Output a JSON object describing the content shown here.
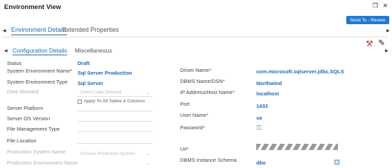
{
  "window": {
    "title": "Environment View",
    "restore_icon": "❐",
    "close_icon": "✕"
  },
  "send_button": "Send To - Review",
  "outer_tabs": [
    {
      "label": "Environment Details",
      "active": true
    },
    {
      "label": "Extended Properties",
      "active": false
    }
  ],
  "inner_tabs": [
    {
      "label": "Configuration Details",
      "active": true
    },
    {
      "label": "Miscellaneous",
      "active": false
    }
  ],
  "left_fields": {
    "status": {
      "label": "Status",
      "value": "Draft"
    },
    "sys_env_name": {
      "label": "System Environment Name",
      "required": "*",
      "value": "Sql Server Production"
    },
    "sys_env_type": {
      "label": "System Environment Type",
      "value": "Sql Server"
    },
    "data_steward": {
      "label": "Data Steward",
      "placeholder": "Select Data Steward"
    },
    "apply_all": {
      "label": "Apply To All Tables & Columns"
    },
    "server_platform": {
      "label": "Server Platform"
    },
    "server_os": {
      "label": "Server OS Version"
    },
    "file_mgmt": {
      "label": "File Management Type"
    },
    "file_location": {
      "label": "File Location"
    },
    "prod_sys_name": {
      "label": "Production System Name",
      "placeholder": "Choose Production System"
    },
    "prod_env_name": {
      "label": "Production Environment Name"
    }
  },
  "right_fields": {
    "driver_name": {
      "label": "Driver Name",
      "required": "*",
      "value": "com.microsoft.sqlserver.jdbc.SQLS"
    },
    "dbms_name": {
      "label": "DBMS Name/DSN",
      "required": "*",
      "value": "Northwind"
    },
    "ip_address": {
      "label": "IP Address/Host Name",
      "required": "*",
      "value": "localhost"
    },
    "port": {
      "label": "Port",
      "value": "1433"
    },
    "user_name": {
      "label": "User Name",
      "required": "*",
      "value": "sa"
    },
    "password": {
      "label": "Password",
      "required": "*"
    },
    "url": {
      "label": "Url",
      "required": "*"
    },
    "db_schema": {
      "label": "DBMS Instance Schema",
      "value": "dbo"
    }
  }
}
